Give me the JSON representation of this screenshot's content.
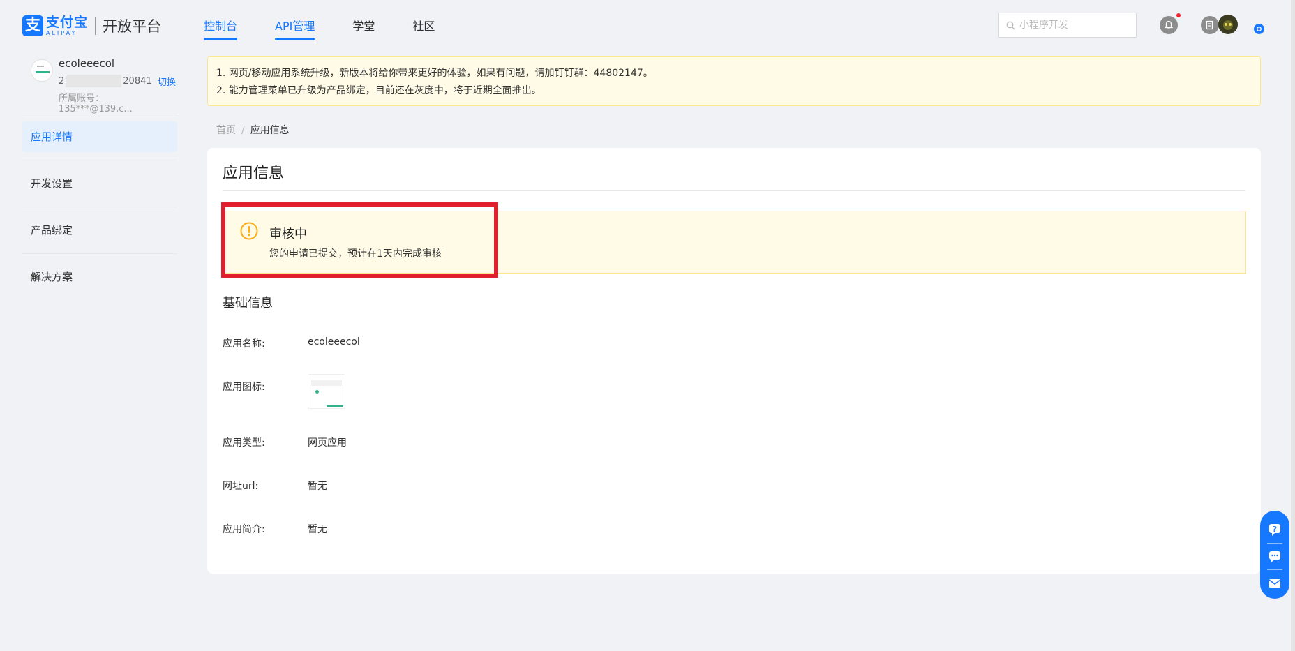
{
  "brand": {
    "mark": "支",
    "name_cn": "支付宝",
    "name_en": "ALIPAY",
    "platform": "开放平台",
    "color": "#1677ff"
  },
  "nav": {
    "items": [
      {
        "label": "控制台",
        "active": true
      },
      {
        "label": "API管理",
        "active": true
      },
      {
        "label": "学堂",
        "active": false
      },
      {
        "label": "社区",
        "active": false
      }
    ]
  },
  "search": {
    "placeholder": "小程序开发",
    "icon": "search-icon"
  },
  "header_icons": [
    "bell-icon",
    "document-icon",
    "avatar",
    "settings-icon"
  ],
  "account": {
    "name": "ecoleeecol",
    "id_prefix": "2",
    "id_suffix": "20841",
    "switch_label": "切换",
    "sub_account": "所属账号：135***@139.c..."
  },
  "sidebar": {
    "items": [
      {
        "label": "应用详情",
        "active": true
      },
      {
        "label": "开发设置",
        "active": false
      },
      {
        "label": "产品绑定",
        "active": false
      },
      {
        "label": "解决方案",
        "active": false
      }
    ]
  },
  "notice": {
    "lines": [
      "1. 网页/移动应用系统升级，新版本将给你带来更好的体验，如果有问题，请加钉钉群：44802147。",
      "2. 能力管理菜单已升级为产品绑定，目前还在灰度中，将于近期全面推出。"
    ]
  },
  "breadcrumb": {
    "home": "首页",
    "separator": "/",
    "current": "应用信息"
  },
  "card": {
    "title": "应用信息",
    "alert": {
      "title": "审核中",
      "description": "您的申请已提交，预计在1天内完成审核",
      "icon": "warning-icon",
      "color": "#faad14"
    },
    "section_title": "基础信息",
    "fields": [
      {
        "label": "应用名称:",
        "value": "ecoleeecol"
      },
      {
        "label": "应用图标:",
        "value": ""
      },
      {
        "label": "应用类型:",
        "value": "网页应用"
      },
      {
        "label": "网址url:",
        "value": "暂无"
      },
      {
        "label": "应用简介:",
        "value": "暂无"
      }
    ]
  },
  "float_tools": [
    "help-icon",
    "chat-icon",
    "mail-icon"
  ],
  "colors": {
    "accent": "#1677ff",
    "highlight": "#e0202e",
    "alert_bg": "#fffbe6",
    "alert_border": "#ffe58f"
  }
}
